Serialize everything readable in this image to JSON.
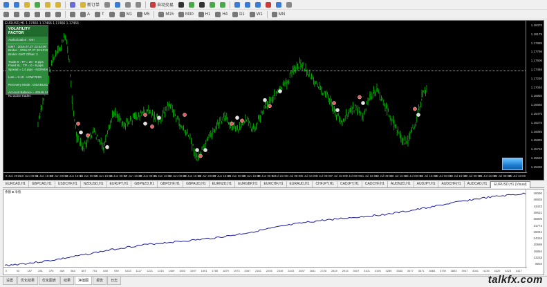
{
  "toolbar1": [
    {
      "icon": "new-chart-icon",
      "color": "#3b7bd6",
      "label": ""
    },
    {
      "icon": "profiles-icon",
      "color": "#3b7bd6",
      "label": ""
    },
    {
      "icon": "market-watch-icon",
      "color": "#d6b33b",
      "label": ""
    },
    {
      "icon": "data-window-icon",
      "color": "#4aa84a",
      "label": ""
    },
    {
      "icon": "navigator-icon",
      "color": "#d6b33b",
      "label": ""
    },
    {
      "icon": "terminal-icon",
      "color": "#d6b33b",
      "label": ""
    },
    {
      "icon": "tester-icon",
      "color": "#6b6bd6",
      "label": ""
    },
    {
      "icon": "new-order-icon",
      "color": "#d6b33b",
      "label": "新订单"
    },
    {
      "icon": "meta-editor-icon",
      "color": "#888",
      "label": ""
    },
    {
      "icon": "options-icon",
      "color": "#3b7bd6",
      "label": ""
    },
    {
      "icon": "m1-icon",
      "color": "#888",
      "label": ""
    },
    {
      "icon": "m5-icon",
      "color": "#888",
      "label": ""
    },
    {
      "icon": "autotrading-icon",
      "color": "#c83b3b",
      "label": "自动交易"
    },
    {
      "icon": "bar-chart-icon",
      "color": "#333",
      "label": ""
    },
    {
      "icon": "candle-icon",
      "color": "#4aa84a",
      "label": ""
    },
    {
      "icon": "line-chart-icon",
      "color": "#333",
      "label": ""
    },
    {
      "icon": "zoom-in-icon",
      "color": "#4aa84a",
      "label": ""
    },
    {
      "icon": "zoom-out-icon",
      "color": "#4aa84a",
      "label": ""
    },
    {
      "icon": "tile-icon",
      "color": "#3b7bd6",
      "label": ""
    },
    {
      "icon": "autoscroll-icon",
      "color": "#3b7bd6",
      "label": ""
    },
    {
      "icon": "shift-icon",
      "color": "#3b7bd6",
      "label": ""
    },
    {
      "icon": "indicators-icon",
      "color": "#c83b3b",
      "label": ""
    },
    {
      "icon": "periods-icon",
      "color": "#3b7bd6",
      "label": ""
    },
    {
      "icon": "templates-icon",
      "color": "#888",
      "label": ""
    }
  ],
  "toolbar2": [
    {
      "icon": "cursor-icon",
      "label": ""
    },
    {
      "icon": "crosshair-icon",
      "label": ""
    },
    {
      "icon": "vertical-line-icon",
      "label": ""
    },
    {
      "icon": "horizontal-line-icon",
      "label": ""
    },
    {
      "icon": "trendline-icon",
      "label": ""
    },
    {
      "icon": "channel-icon",
      "label": ""
    },
    {
      "icon": "fibonacci-icon",
      "label": ""
    },
    {
      "icon": "text-icon",
      "label": "A"
    },
    {
      "icon": "label-icon",
      "label": "T"
    },
    {
      "icon": "arrows-icon",
      "label": ""
    },
    {
      "icon": "m1-period-icon",
      "label": "M1"
    },
    {
      "icon": "m5-period-icon",
      "label": "M5"
    },
    {
      "icon": "m15-period-icon",
      "label": "M15"
    },
    {
      "icon": "m30-period-icon",
      "label": "M30"
    },
    {
      "icon": "h1-period-icon",
      "label": "H1"
    },
    {
      "icon": "h4-period-icon",
      "label": "H4"
    },
    {
      "icon": "d1-period-icon",
      "label": "D1"
    },
    {
      "icon": "w1-period-icon",
      "label": "W1"
    },
    {
      "icon": "mn-period-icon",
      "label": "MN"
    }
  ],
  "chart": {
    "header": "EURUSD,H1  1.17466 1.17466 1.17466 1.17466",
    "colors": {
      "bg": "#000000",
      "candle": "#00c800",
      "marker_buy": "#e06060",
      "marker_sell": "#e0e0e0"
    },
    "price_labels": [
      "1.18370",
      "1.18175",
      "1.17985",
      "1.17795",
      "1.17606",
      "1.17466",
      "1.17230",
      "1.17040",
      "1.16850",
      "1.16660",
      "1.16470",
      "1.16275",
      "1.16085",
      "1.15895",
      "1.15710",
      "1.15520",
      "1.15330"
    ],
    "time_labels": [
      "9 Jun 2016",
      "10 Jun 08:00",
      "11 Jun 16:00",
      "12 Jun 08:00",
      "13 Jun 16:00",
      "14 Jun 08:00",
      "15 Jun 16:00",
      "16 Jun 08:00",
      "17 Jun 16:00",
      "20 Jun 08:00",
      "21 Jun 16:00",
      "22 Jun 08:00",
      "23 Jun 16:00",
      "24 Jun 08:00",
      "27 Jun 16:00",
      "28 Jun 08:00",
      "29 Jun 16:00",
      "30 Jun 08:00",
      "1 Jul 16:00",
      "4 Jul 08:00",
      "5 Jul 16:00",
      "6 Jul 08:00",
      "7 Jul 16:00",
      "8 Jul 08:00",
      "11 Jul 16:00",
      "12 Jul 08:00",
      "13 Jul 16:00",
      "14 Jul 08:00",
      "15 Jul 16:00",
      "18 Jul 08:00",
      "19 Jul 16:00",
      "20 Jul 08:00",
      "21 Jul 16:00",
      "22 Jul 08:00",
      "25 Jul 16:00"
    ],
    "panel": {
      "title": "VOLATILITY FACTOR",
      "auth": "Authorization : OK!",
      "lines": [
        "GMT : 2016.07.27 23:43:00",
        "Broker : 2016.07.27 20:43:00",
        "Broker GMT Offset: 3",
        "",
        "Trade 0 : TP = 30 - 9 pips",
        "Fixed SL : TP = 0 - 9 pips",
        "Spread = 1.0 pips - NORMAL",
        "",
        "Lots = 0.10 - LOW RISK",
        "",
        "Recovery Mode : DISABLED",
        "",
        "Account Balance = 48445.14",
        "No active trades"
      ]
    }
  },
  "symbol_tabs": [
    "EURCAD,H1",
    "GBPCAD,H1",
    "USDCHF,H1",
    "NZDUSD,H1",
    "EURJPY,H1",
    "GBPNZD,H1",
    "GBPCHF,H1",
    "GBPAUD,H1",
    "EURNZD,H1",
    "EURGBP,H1",
    "EURCHF,H1",
    "EURAUD,H1",
    "CHFJPY,H1",
    "CADJPY,H1",
    "CADCHF,H1",
    "AUDNZD,H1",
    "AUDJPY,H1",
    "AUDCHF,H1",
    "AUDCAD,H1",
    "EURUSD,H1 (Visual)"
  ],
  "active_symbol_tab": 19,
  "graph": {
    "header": "余额 ■ 净值",
    "line_color": "#1a1aa0",
    "scale_labels": [
      "49090",
      "46935",
      "43423",
      "39631",
      "35806",
      "31774",
      "28042",
      "24316",
      "20598",
      "16854",
      "13228",
      "9504"
    ],
    "x_labels": [
      "0",
      "93",
      "187",
      "281",
      "375",
      "469",
      "563",
      "657",
      "751",
      "845",
      "939",
      "1033",
      "1127",
      "1221",
      "1315",
      "1409",
      "1503",
      "1597",
      "1691",
      "1785",
      "1879",
      "1973",
      "2067",
      "2161",
      "2255",
      "2349",
      "2443",
      "2537",
      "2631",
      "2725",
      "2819",
      "2913",
      "3007",
      "3101",
      "3195",
      "3289",
      "3383",
      "3477",
      "3571",
      "3665",
      "3759",
      "3853",
      "3947",
      "4041",
      "4135",
      "4229",
      "4323",
      "4417"
    ]
  },
  "bottom_tabs": [
    "设置",
    "优化结果",
    "优化图表",
    "结果",
    "净值图",
    "报告",
    "日志"
  ],
  "active_bottom_tab": 4,
  "watermark": "talkfx.com"
}
